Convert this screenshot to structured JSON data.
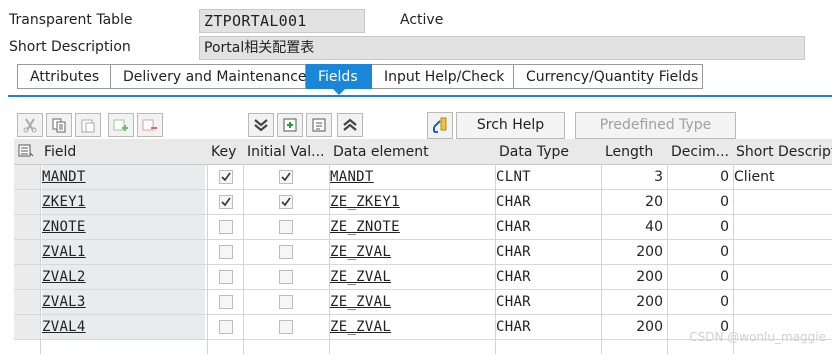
{
  "header": {
    "transparent_table_label": "Transparent Table",
    "table_name": "ZTPORTAL001",
    "status": "Active",
    "short_description_label": "Short Description",
    "short_description": "Portal相关配置表"
  },
  "tabs": [
    {
      "label": "Attributes",
      "active": false
    },
    {
      "label": "Delivery and Maintenance",
      "active": false
    },
    {
      "label": "Fields",
      "active": true
    },
    {
      "label": "Input Help/Check",
      "active": false
    },
    {
      "label": "Currency/Quantity Fields",
      "active": false
    }
  ],
  "toolbar": {
    "icons": [
      "cut-icon",
      "copy-icon",
      "paste-icon",
      "insert-row-icon",
      "delete-row-icon",
      "collapse-all-icon",
      "new-field-icon",
      "details-icon",
      "expand-all-icon",
      "search-help-icon"
    ],
    "search_help_label": "Srch Help",
    "predefined_type_label": "Predefined Type"
  },
  "table": {
    "columns": [
      "Field",
      "Key",
      "Initial Val...",
      "Data element",
      "Data Type",
      "Length",
      "Decim...",
      "Short Descripti"
    ],
    "rows": [
      {
        "field": "MANDT",
        "key": true,
        "initial": true,
        "data_element": "MANDT",
        "data_type": "CLNT",
        "length": "3",
        "decimals": "0",
        "short_desc": "Client"
      },
      {
        "field": "ZKEY1",
        "key": true,
        "initial": true,
        "data_element": "ZE_ZKEY1",
        "data_type": "CHAR",
        "length": "20",
        "decimals": "0",
        "short_desc": ""
      },
      {
        "field": "ZNOTE",
        "key": false,
        "initial": false,
        "data_element": "ZE_ZNOTE",
        "data_type": "CHAR",
        "length": "40",
        "decimals": "0",
        "short_desc": ""
      },
      {
        "field": "ZVAL1",
        "key": false,
        "initial": false,
        "data_element": "ZE_ZVAL",
        "data_type": "CHAR",
        "length": "200",
        "decimals": "0",
        "short_desc": ""
      },
      {
        "field": "ZVAL2",
        "key": false,
        "initial": false,
        "data_element": "ZE_ZVAL",
        "data_type": "CHAR",
        "length": "200",
        "decimals": "0",
        "short_desc": ""
      },
      {
        "field": "ZVAL3",
        "key": false,
        "initial": false,
        "data_element": "ZE_ZVAL",
        "data_type": "CHAR",
        "length": "200",
        "decimals": "0",
        "short_desc": ""
      },
      {
        "field": "ZVAL4",
        "key": false,
        "initial": false,
        "data_element": "ZE_ZVAL",
        "data_type": "CHAR",
        "length": "200",
        "decimals": "0",
        "short_desc": ""
      }
    ]
  },
  "watermark": "CSDN @wonlu_maggie",
  "colors": {
    "accent": "#1a86d8",
    "field_bg": "#e2e2e2",
    "header_bg": "#e9e9e9"
  }
}
